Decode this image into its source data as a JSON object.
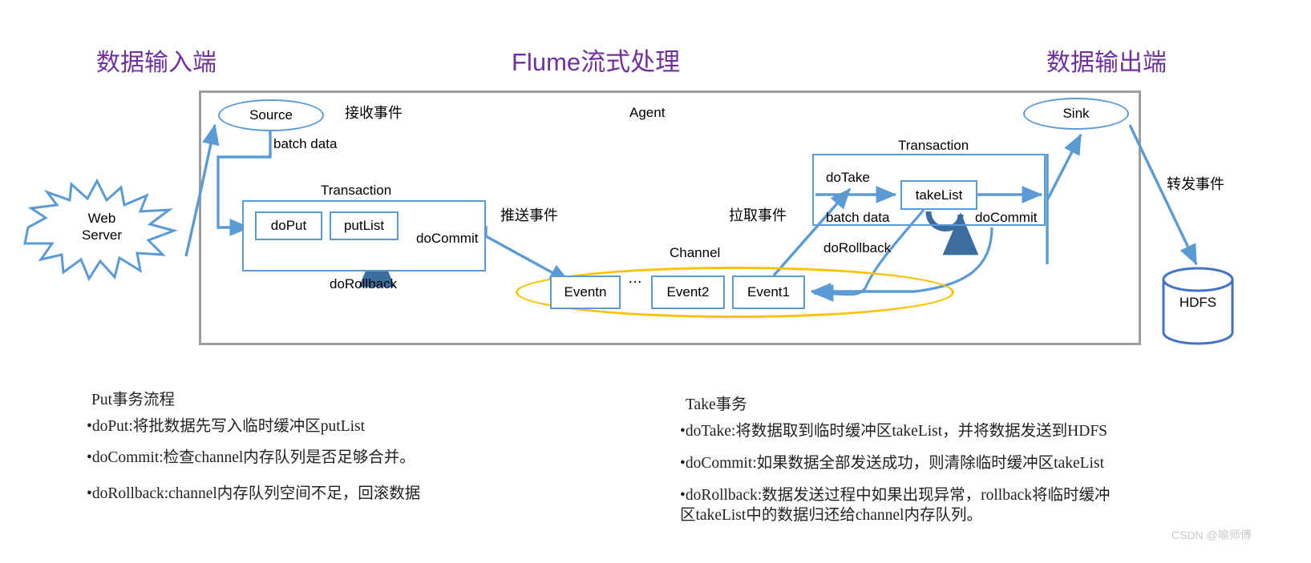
{
  "titles": {
    "input": "数据输入端",
    "center": "Flume流式处理",
    "output": "数据输出端",
    "accent_color": "#7030A0"
  },
  "agent": {
    "label": "Agent",
    "border_color": "#9e9e9e"
  },
  "colors": {
    "node_blue": "#5B9BD5",
    "channel_yellow": "#FFC000",
    "arrow_blue": "#5B9BD5",
    "loop_arrow_blue": "#3B6E9E"
  },
  "nodes": {
    "web_server": "Web\nServer",
    "web_server_line1": "Web",
    "web_server_line2": "Server",
    "source": "Source",
    "sink": "Sink",
    "hdfs": "HDFS",
    "do_put": "doPut",
    "put_list": "putList",
    "take_list": "takeList",
    "event_n": "Eventn",
    "event_2": "Event2",
    "event_1": "Event1",
    "event_ellipsis": "…"
  },
  "labels": {
    "receive_event": "接收事件",
    "batch_data_left": "batch data",
    "transaction_left": "Transaction",
    "do_commit_left": "doCommit",
    "do_rollback_left": "doRollback",
    "push_event": "推送事件",
    "pull_event": "拉取事件",
    "channel": "Channel",
    "transaction_right": "Transaction",
    "do_take": "doTake",
    "batch_data_right": "batch data",
    "do_commit_right": "doCommit",
    "do_rollback_right": "doRollback",
    "forward_event": "转发事件"
  },
  "notes": {
    "left": {
      "title": "Put事务流程",
      "items": [
        "•doPut:将批数据先写入临时缓冲区putList",
        "•doCommit:检查channel内存队列是否足够合并。",
        "•doRollback:channel内存队列空间不足，回滚数据"
      ]
    },
    "right": {
      "title": "Take事务",
      "items": [
        "•doTake:将数据取到临时缓冲区takeList，并将数据发送到HDFS",
        "•doCommit:如果数据全部发送成功，则清除临时缓冲区takeList",
        "•doRollback:数据发送过程中如果出现异常，rollback将临时缓冲",
        "区takeList中的数据归还给channel内存队列。"
      ]
    }
  },
  "watermark": "CSDN @喻师傅"
}
